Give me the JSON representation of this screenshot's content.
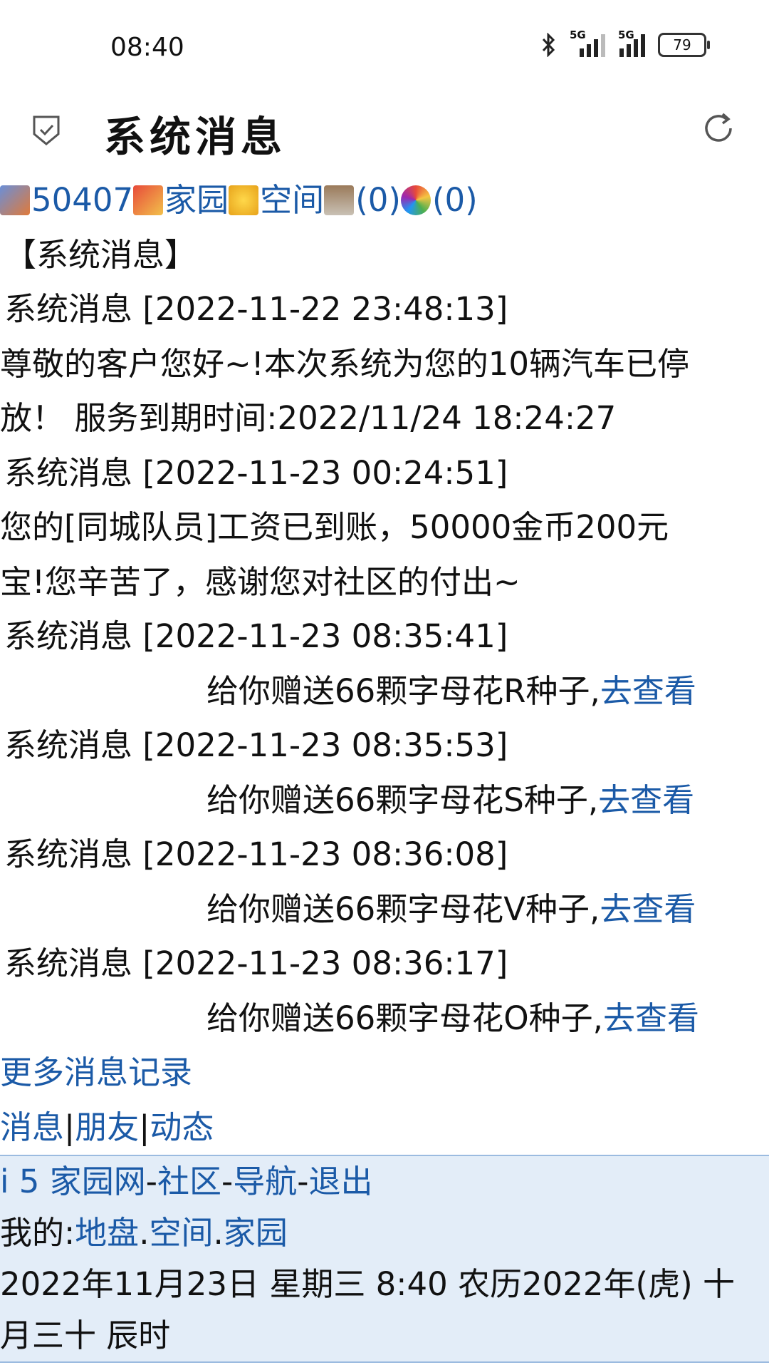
{
  "status": {
    "time": "08:40",
    "net1": "5G",
    "net2": "5G",
    "battery": "79"
  },
  "header": {
    "title": "系统消息"
  },
  "topnav": {
    "user_id": "50407",
    "home": "家园",
    "space": "空间",
    "bank_count": "(0)",
    "lucky_count": "(0)"
  },
  "section_title": "【系统消息】",
  "messages": [
    {
      "header": "系统消息 [2022-11-22 23:48:13]",
      "lines": [
        "尊敬的客户您好~!本次系统为您的10辆汽车已停",
        "放！ 服务到期时间:2022/11/24 18:24:27"
      ]
    },
    {
      "header": "系统消息 [2022-11-23 00:24:51]",
      "lines": [
        "您的[同城队员]工资已到账，50000金币200元",
        "宝!您辛苦了，感谢您对社区的付出~"
      ]
    },
    {
      "header": "系统消息 [2022-11-23 08:35:41]",
      "gift": "给你赠送66颗字母花R种子,",
      "link": "去查看"
    },
    {
      "header": "系统消息 [2022-11-23 08:35:53]",
      "gift": "给你赠送66颗字母花S种子,",
      "link": "去查看"
    },
    {
      "header": "系统消息 [2022-11-23 08:36:08]",
      "gift": "给你赠送66颗字母花V种子,",
      "link": "去查看"
    },
    {
      "header": "系统消息 [2022-11-23 08:36:17]",
      "gift": "给你赠送66颗字母花O种子,",
      "link": "去查看"
    }
  ],
  "more_link": "更多消息记录",
  "subnav": {
    "messages": "消息",
    "friends": "朋友",
    "activity": "动态",
    "sep": "|"
  },
  "footer": {
    "site": "i 5 家园网",
    "community": "社区",
    "navigation": "导航",
    "logout": "退出",
    "dash": "-",
    "mine_label": "我的:",
    "plot": "地盘",
    "space": "空间",
    "home": "家园",
    "dot": ".",
    "date_line1": "2022年11月23日  星期三  8:40  农历2022年(虎) 十",
    "date_line2": "月三十  辰时"
  }
}
